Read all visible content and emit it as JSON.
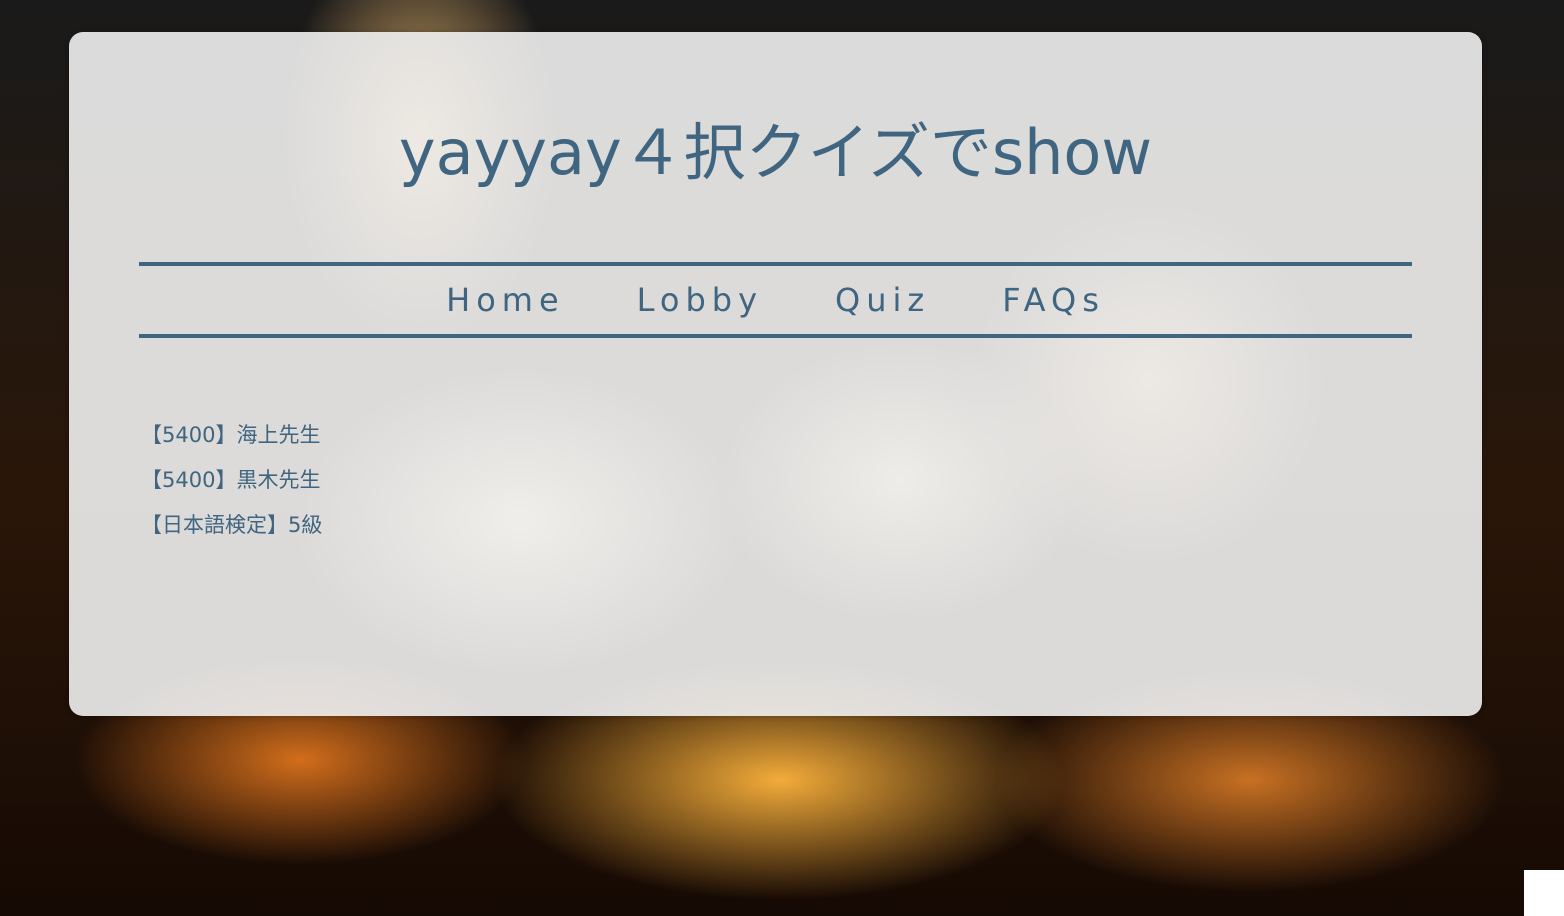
{
  "site": {
    "title": "yayyay４択クイズでshow"
  },
  "nav": {
    "items": [
      {
        "label": "Home"
      },
      {
        "label": "Lobby"
      },
      {
        "label": "Quiz"
      },
      {
        "label": "FAQs"
      }
    ]
  },
  "main": {
    "links": [
      {
        "label": "【5400】海上先生"
      },
      {
        "label": "【5400】黒木先生"
      },
      {
        "label": "【日本語検定】5級"
      }
    ]
  },
  "colors": {
    "accent": "#3f6580",
    "panel": "#eeeeee"
  }
}
